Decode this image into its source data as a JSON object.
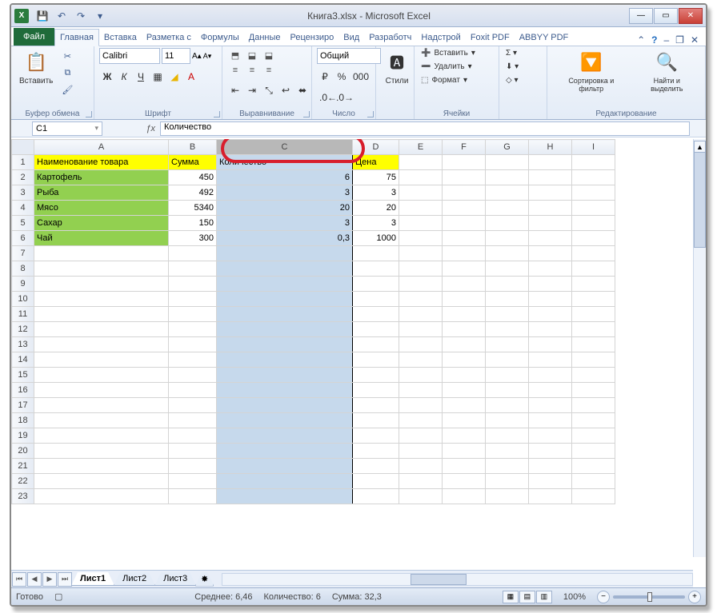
{
  "window": {
    "filename": "Книга3.xlsx",
    "app": "Microsoft Excel"
  },
  "qat": {
    "save": "💾",
    "undo": "↶",
    "redo": "↷"
  },
  "tabs": {
    "file": "Файл",
    "list": [
      "Главная",
      "Вставка",
      "Разметка с",
      "Формулы",
      "Данные",
      "Рецензиро",
      "Вид",
      "Разработч",
      "Надстрой",
      "Foxit PDF",
      "ABBYY PDF"
    ]
  },
  "ribbon": {
    "clipboard": {
      "paste": "Вставить",
      "label": "Буфер обмена"
    },
    "font": {
      "name": "Calibri",
      "size": "11",
      "label": "Шрифт"
    },
    "align": {
      "label": "Выравнивание"
    },
    "number": {
      "format": "Общий",
      "label": "Число"
    },
    "styles": {
      "btn": "Стили",
      "label": ""
    },
    "cells": {
      "insert": "Вставить",
      "delete": "Удалить",
      "format": "Формат",
      "label": "Ячейки"
    },
    "editing": {
      "sort": "Сортировка и фильтр",
      "find": "Найти и выделить",
      "label": "Редактирование"
    }
  },
  "namebox": "C1",
  "formula": "Количество",
  "columns": [
    "A",
    "B",
    "C",
    "D",
    "E",
    "F",
    "G",
    "H",
    "I"
  ],
  "headers": {
    "a": "Наименование товара",
    "b": "Сумма",
    "c": "Количество",
    "d": "Цена"
  },
  "rows": [
    {
      "a": "Картофель",
      "b": "450",
      "c": "6",
      "d": "75"
    },
    {
      "a": "Рыба",
      "b": "492",
      "c": "3",
      "d": "3"
    },
    {
      "a": "Мясо",
      "b": "5340",
      "c": "20",
      "d": "20"
    },
    {
      "a": "Сахар",
      "b": "150",
      "c": "3",
      "d": "3"
    },
    {
      "a": "Чай",
      "b": "300",
      "c": "0,3",
      "d": "1000"
    }
  ],
  "sheets": [
    "Лист1",
    "Лист2",
    "Лист3"
  ],
  "status": {
    "ready": "Готово",
    "avg_label": "Среднее:",
    "avg": "6,46",
    "count_label": "Количество:",
    "count": "6",
    "sum_label": "Сумма:",
    "sum": "32,3",
    "zoom": "100%"
  }
}
